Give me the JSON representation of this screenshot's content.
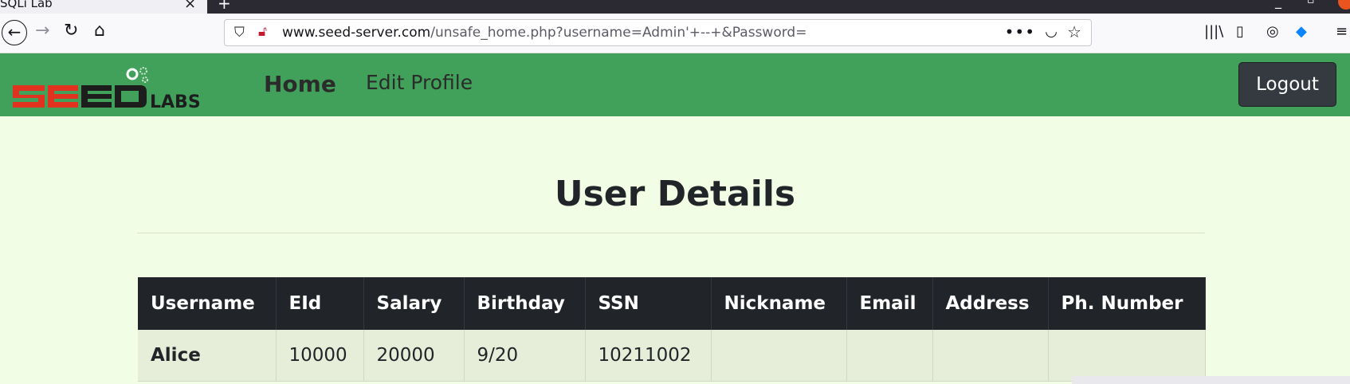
{
  "browser": {
    "tab_title": "SQLi Lab",
    "tab_close": "×",
    "new_tab": "+",
    "url_domain": "www.seed-server.com",
    "url_path": "/unsafe_home.php?username=Admin'+--+&Password="
  },
  "header": {
    "nav": [
      {
        "label": "Home",
        "active": true
      },
      {
        "label": "Edit Profile",
        "active": false
      }
    ],
    "logout_label": "Logout"
  },
  "main": {
    "title": "User Details",
    "table": {
      "columns": [
        "Username",
        "EId",
        "Salary",
        "Birthday",
        "SSN",
        "Nickname",
        "Email",
        "Address",
        "Ph. Number"
      ],
      "rows": [
        [
          "Alice",
          "10000",
          "20000",
          "9/20",
          "10211002",
          "",
          "",
          "",
          ""
        ]
      ]
    }
  },
  "colors": {
    "header_bg": "#41a15a",
    "page_bg": "#f2fde5",
    "table_head_bg": "#212529",
    "logo_red": "#e0321f",
    "logo_dark": "#1d1d1d"
  }
}
